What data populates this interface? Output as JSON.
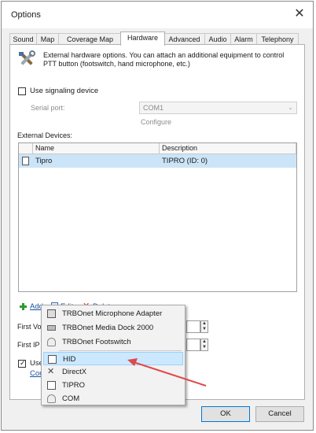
{
  "window": {
    "title": "Options"
  },
  "tabs": [
    "Sound",
    "Map",
    "Coverage Map",
    "Hardware",
    "Advanced",
    "Audio",
    "Alarm",
    "Telephony"
  ],
  "hardware": {
    "description": "External hardware options. You can attach an additional equipment to control PTT button (footswitch, hand microphone, etc.)",
    "use_signaling_label": "Use signaling device",
    "serial_port_label": "Serial port:",
    "serial_port_value": "COM1",
    "configure_link": "Configure",
    "external_devices_label": "External Devices:",
    "columns": [
      "Name",
      "Description"
    ],
    "devices": [
      {
        "name": "Tipro",
        "description": "TIPRO (ID: 0)"
      }
    ],
    "add_label": "Add",
    "edit_label": "Edit",
    "delete_label": "Delete",
    "first_vo_label": "First Vo",
    "first_ip_label": "First IP",
    "use_label": "Use",
    "con_link": "Con"
  },
  "menu": {
    "items_top": [
      "TRBOnet Microphone Adapter",
      "TRBOnet Media Dock 2000",
      "TRBOnet Footswitch"
    ],
    "items_bottom": [
      "HID",
      "DirectX",
      "TIPRO",
      "COM"
    ],
    "highlighted": "HID"
  },
  "buttons": {
    "ok": "OK",
    "cancel": "Cancel"
  },
  "colors": {
    "selection": "#cce4f7",
    "menu_highlight": "#cce8ff",
    "arrow": "#e0494b",
    "link": "#1a4fa0"
  }
}
